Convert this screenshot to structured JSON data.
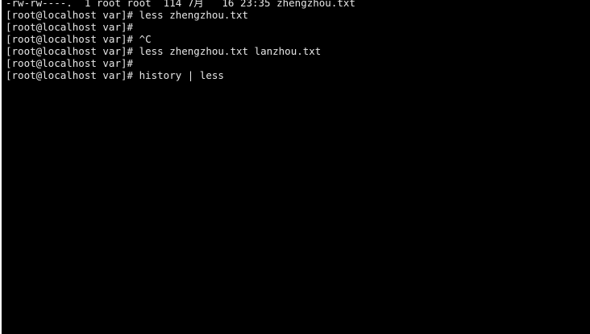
{
  "terminal": {
    "lines": [
      "-rw-rw----.  1 root root  114 7月   16 23:35 zhengzhou.txt",
      "[root@localhost var]# less zhengzhou.txt",
      "[root@localhost var]#",
      "[root@localhost var]# ^C",
      "[root@localhost var]# less zhengzhou.txt lanzhou.txt",
      "[root@localhost var]#",
      "[root@localhost var]# history | less"
    ]
  },
  "colors": {
    "background": "#000000",
    "foreground": "#e6e6e6"
  }
}
